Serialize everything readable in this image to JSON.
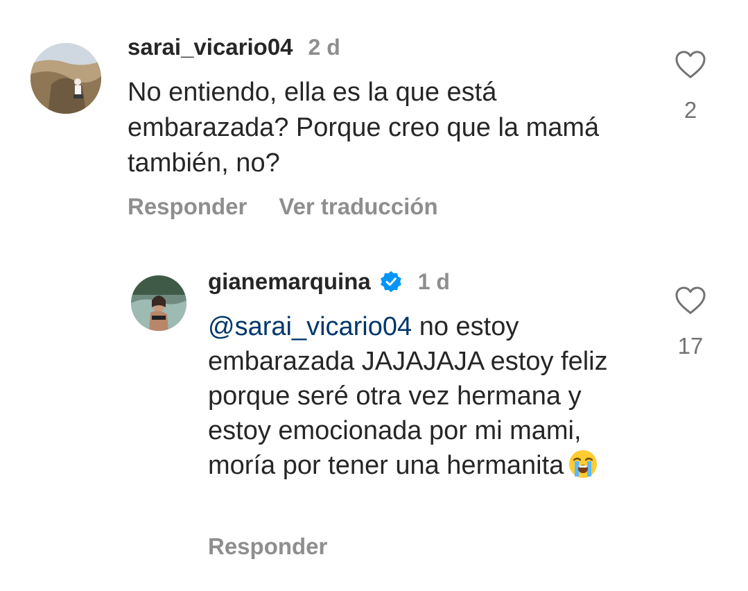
{
  "comments": [
    {
      "username": "sarai_vicario04",
      "time": "2 d",
      "text": "No entiendo, ella es la que está embarazada? Porque creo que la mamá también, no?",
      "actions": {
        "reply": "Responder",
        "translate": "Ver traducción"
      },
      "likes": "2"
    },
    {
      "username": "gianemarquina",
      "verified": true,
      "time": "1 d",
      "mention": "@sarai_vicario04",
      "text": " no estoy embarazada JAJAJAJA estoy feliz porque seré otra vez hermana y estoy emocionada por mi mami, moría por tener una hermanita",
      "emoji": "loudly-crying-face",
      "actions": {
        "reply": "Responder"
      },
      "likes": "17"
    }
  ],
  "colors": {
    "text": "#262626",
    "secondary": "#8e8e8e",
    "mention": "#00376b",
    "verified": "#0095f6"
  }
}
